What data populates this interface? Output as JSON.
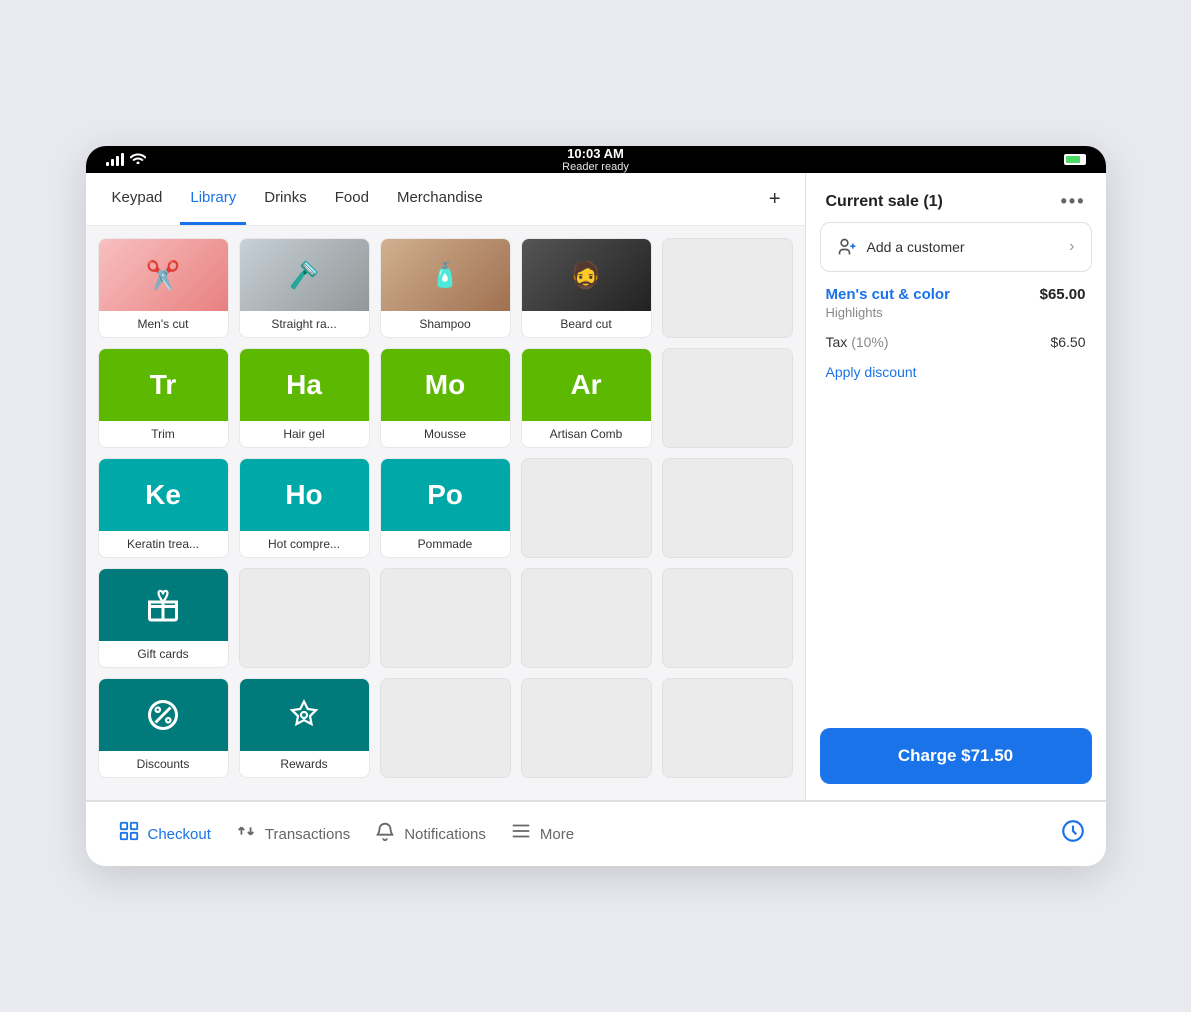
{
  "statusBar": {
    "time": "10:03 AM",
    "subtitle": "Reader ready"
  },
  "tabs": [
    {
      "id": "keypad",
      "label": "Keypad",
      "active": false
    },
    {
      "id": "library",
      "label": "Library",
      "active": true
    },
    {
      "id": "drinks",
      "label": "Drinks",
      "active": false
    },
    {
      "id": "food",
      "label": "Food",
      "active": false
    },
    {
      "id": "merchandise",
      "label": "Merchandise",
      "active": false
    }
  ],
  "tabAdd": "+",
  "grid": {
    "row1": [
      {
        "id": "mens-cut",
        "type": "photo",
        "photoType": "scissors",
        "label": "Men's cut",
        "icon": "✂️"
      },
      {
        "id": "straight-ra",
        "type": "photo",
        "photoType": "razor",
        "label": "Straight ra...",
        "icon": "🪒"
      },
      {
        "id": "shampoo",
        "type": "photo",
        "photoType": "shampoo",
        "label": "Shampoo",
        "icon": "🧴"
      },
      {
        "id": "beard-cut",
        "type": "photo",
        "photoType": "beard",
        "label": "Beard cut",
        "icon": "🧔"
      },
      {
        "id": "empty1",
        "type": "empty",
        "label": ""
      }
    ],
    "row2": [
      {
        "id": "trim",
        "type": "color",
        "color": "green",
        "abbr": "Tr",
        "label": "Trim"
      },
      {
        "id": "hair-gel",
        "type": "color",
        "color": "green",
        "abbr": "Ha",
        "label": "Hair gel"
      },
      {
        "id": "mousse",
        "type": "color",
        "color": "green",
        "abbr": "Mo",
        "label": "Mousse"
      },
      {
        "id": "artisan-comb",
        "type": "color",
        "color": "green",
        "abbr": "Ar",
        "label": "Artisan Comb"
      },
      {
        "id": "empty2",
        "type": "empty",
        "label": ""
      }
    ],
    "row3": [
      {
        "id": "keratin",
        "type": "color",
        "color": "teal",
        "abbr": "Ke",
        "label": "Keratin trea..."
      },
      {
        "id": "hot-compress",
        "type": "color",
        "color": "teal",
        "abbr": "Ho",
        "label": "Hot compre..."
      },
      {
        "id": "pommade",
        "type": "color",
        "color": "teal",
        "abbr": "Po",
        "label": "Pommade"
      },
      {
        "id": "empty3",
        "type": "empty",
        "label": ""
      },
      {
        "id": "empty4",
        "type": "empty",
        "label": ""
      }
    ],
    "row4": [
      {
        "id": "gift-cards",
        "type": "icon",
        "iconType": "gift",
        "label": "Gift cards"
      },
      {
        "id": "empty5",
        "type": "empty",
        "label": ""
      },
      {
        "id": "empty6",
        "type": "empty",
        "label": ""
      },
      {
        "id": "empty7",
        "type": "empty",
        "label": ""
      },
      {
        "id": "empty8",
        "type": "empty",
        "label": ""
      }
    ],
    "row5": [
      {
        "id": "discounts",
        "type": "icon",
        "iconType": "discount",
        "label": "Discounts"
      },
      {
        "id": "rewards",
        "type": "icon",
        "iconType": "rewards",
        "label": "Rewards"
      },
      {
        "id": "empty9",
        "type": "empty",
        "label": ""
      },
      {
        "id": "empty10",
        "type": "empty",
        "label": ""
      },
      {
        "id": "empty11",
        "type": "empty",
        "label": ""
      }
    ]
  },
  "rightPanel": {
    "saleHeader": "Current sale (1)",
    "moreDotsLabel": "•••",
    "addCustomer": "Add a customer",
    "saleItem": {
      "name": "Men's cut & color",
      "price": "$65.00",
      "subtitle": "Highlights"
    },
    "tax": {
      "label": "Tax",
      "rate": "(10%)",
      "amount": "$6.50"
    },
    "applyDiscount": "Apply discount",
    "chargeButton": "Charge $71.50"
  },
  "bottomNav": [
    {
      "id": "checkout",
      "label": "Checkout",
      "active": true,
      "icon": "grid"
    },
    {
      "id": "transactions",
      "label": "Transactions",
      "active": false,
      "icon": "arrows"
    },
    {
      "id": "notifications",
      "label": "Notifications",
      "active": false,
      "icon": "bell"
    },
    {
      "id": "more",
      "label": "More",
      "active": false,
      "icon": "menu"
    }
  ],
  "clockIcon": "⏰"
}
